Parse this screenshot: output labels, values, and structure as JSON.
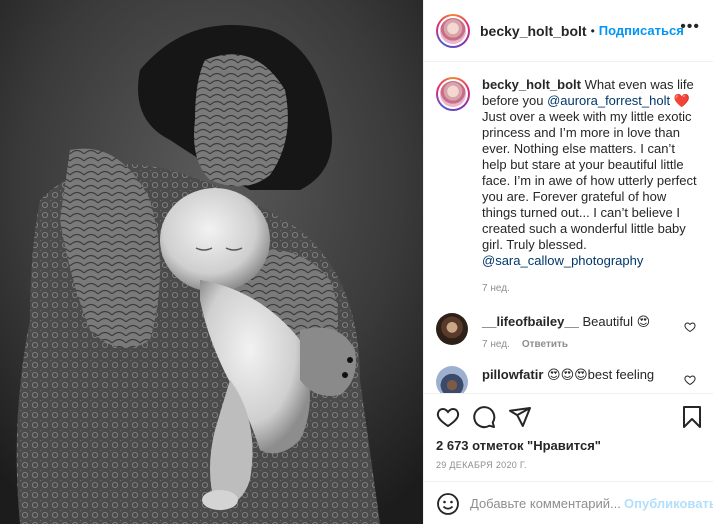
{
  "header": {
    "username": "becky_holt_bolt",
    "separator": "•",
    "follow_label": "Подписаться",
    "more_icon": "more-horizontal-icon"
  },
  "caption": {
    "username": "becky_holt_bolt",
    "text_before_mention": "What even was life before you",
    "mention": "@aurora_forrest_holt",
    "heart": "❤️",
    "text_after": "Just over a week with my little exotic princess and I’m more in love than ever. Nothing else matters. I can’t help but stare at your beautiful little face. I’m in awe of how utterly perfect you are. Forever grateful of how things turned out... I can’t believe I created such a wonderful little baby girl. Truly blessed.",
    "credit": "@sara_callow_photography",
    "time": "7 нед."
  },
  "comments": [
    {
      "username": "__lifeofbailey__",
      "text": "Beautiful 😍",
      "time": "7 нед.",
      "reply_label": "Ответить"
    },
    {
      "username": "pillowfatir",
      "text": "😍😍😍best feeling"
    }
  ],
  "actions": {
    "like_icon": "heart-outline-icon",
    "comment_icon": "comment-bubble-icon",
    "share_icon": "paper-plane-icon",
    "save_icon": "bookmark-icon",
    "likes_text": "2 673 отметок \"Нравится\"",
    "date": "29 ДЕКАБРЯ 2020 Г."
  },
  "add_comment": {
    "emoji_icon": "smiley-icon",
    "placeholder": "Добавьте комментарий...",
    "publish_label": "Опубликовать"
  },
  "colors": {
    "accent": "#0095f6",
    "publish_disabled": "#b2dffc",
    "muted": "#8e8e8e",
    "text": "#262626",
    "heart": "#ed1a3a"
  }
}
